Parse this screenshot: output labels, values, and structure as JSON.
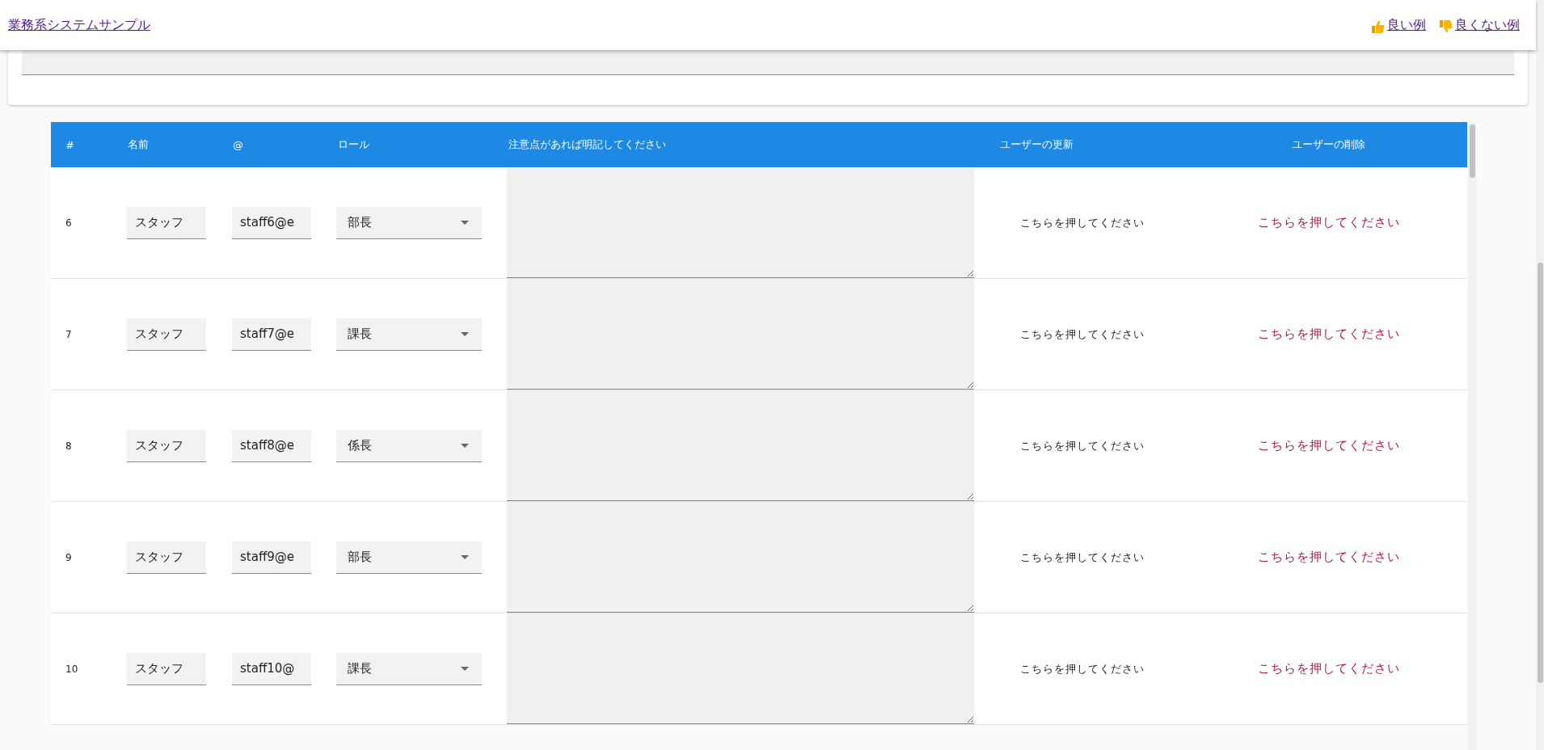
{
  "header": {
    "title": "業務系システムサンプル",
    "links": [
      {
        "kind": "good",
        "label": "良い例"
      },
      {
        "kind": "bad",
        "label": "良くない例"
      }
    ]
  },
  "table": {
    "columns": [
      "#",
      "名前",
      "@",
      "ロール",
      "注意点があれば明記してください",
      "ユーザーの更新",
      "ユーザーの削除"
    ],
    "rows": [
      {
        "number": "6",
        "name": "スタッフ",
        "email": "staff6@e",
        "role": "部長",
        "update_button": "こちらを押してください",
        "delete_button": "こちらを押してください"
      },
      {
        "number": "7",
        "name": "スタッフ",
        "email": "staff7@e",
        "role": "課長",
        "update_button": "こちらを押してください",
        "delete_button": "こちらを押してください"
      },
      {
        "number": "8",
        "name": "スタッフ",
        "email": "staff8@e",
        "role": "係長",
        "update_button": "こちらを押してください",
        "delete_button": "こちらを押してください"
      },
      {
        "number": "9",
        "name": "スタッフ",
        "email": "staff9@e",
        "role": "部長",
        "update_button": "こちらを押してください",
        "delete_button": "こちらを押してください"
      },
      {
        "number": "10",
        "name": "スタッフ",
        "email": "staff10@",
        "role": "課長",
        "update_button": "こちらを押してください",
        "delete_button": "こちらを押してください"
      }
    ]
  }
}
